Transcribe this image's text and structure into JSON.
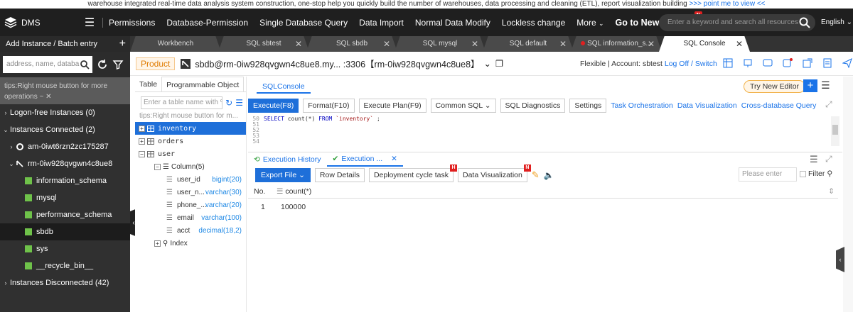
{
  "banner": {
    "text": "warehouse integrated real-time data analysis system construction, one-stop help you quickly build the number of warehouses, data processing and cleaning (ETL), report visualization building",
    "link": ">>> point me to view <<"
  },
  "topbar": {
    "logo": "DMS",
    "nav": [
      "Permissions",
      "Database-Permission",
      "Single Database Query",
      "Data Import",
      "Normal Data Modify",
      "Lockless change",
      "More",
      "Go to New Version"
    ],
    "new_badge": "N",
    "search_placeholder": "Enter a keyword and search all resources",
    "language": "English"
  },
  "sidebar": {
    "header": "Add Instance / Batch entry",
    "search_placeholder": "address, name, databa",
    "tips": "tips:Right mouse button for more operations ~",
    "items": [
      {
        "label": "Logon-free Instances  (0)"
      },
      {
        "label": "Instances Connected  (2)"
      },
      {
        "label": "am-0iwt6rzn2zc175287"
      },
      {
        "label": "rm-0iw928qvgwn4c8ue8"
      },
      {
        "label": "information_schema"
      },
      {
        "label": "mysql"
      },
      {
        "label": "performance_schema"
      },
      {
        "label": "sbdb"
      },
      {
        "label": "sys"
      },
      {
        "label": "__recycle_bin__"
      },
      {
        "label": "Instances Disconnected  (42)"
      }
    ]
  },
  "tabs": [
    {
      "label": "Workbench"
    },
    {
      "label": "SQL sbtest"
    },
    {
      "label": "SQL sbdb"
    },
    {
      "label": "SQL mysql"
    },
    {
      "label": "SQL default"
    },
    {
      "label": "SQL information_s..."
    },
    {
      "label": "SQL Console"
    }
  ],
  "infobar": {
    "product": "Product",
    "connection": "sbdb@rm-0iw928qvgwn4c8ue8.my...  :3306【rm-0iw928qvgwn4c8ue8】",
    "account_prefix": "Flexible | Account: sbtest",
    "logoff": "Log Off / Switch"
  },
  "objects": {
    "tab_table": "Table",
    "tab_programmable": "Programmable Object",
    "search_placeholder": "Enter a table name with % f",
    "tips": "tips:Right mouse button for m...",
    "tables": [
      "inventory",
      "orders",
      "user"
    ],
    "column_group": "Column(5)",
    "columns": [
      {
        "name": "user_id",
        "type": "bigint(20)"
      },
      {
        "name": "user_n...",
        "type": "varchar(30)"
      },
      {
        "name": "phone_...",
        "type": "varchar(20)"
      },
      {
        "name": "email",
        "type": "varchar(100)"
      },
      {
        "name": "acct",
        "type": "decimal(18,2)"
      }
    ],
    "index_group": "Index"
  },
  "editor": {
    "tab": "SQLConsole",
    "try_new": "Try New Editor",
    "toolbar": {
      "execute": "Execute(F8)",
      "format": "Format(F10)",
      "plan": "Execute Plan(F9)",
      "common_sql": "Common SQL",
      "diagnostics": "SQL Diagnostics",
      "settings": "Settings",
      "links": [
        "Task Orchestration",
        "Data Visualization",
        "Cross-database Query"
      ]
    },
    "lines": [
      {
        "no": "50",
        "kw1": "SELECT",
        "fn": "count(*)",
        "kw2": "FROM",
        "tbl": "`inventory`",
        "tail": ";"
      },
      {
        "no": "51"
      },
      {
        "no": "52"
      },
      {
        "no": "53"
      },
      {
        "no": "54"
      }
    ]
  },
  "results": {
    "history_tab": "Execution History",
    "exec_tab": "Execution ...",
    "export": "Export File",
    "row_details": "Row Details",
    "deploy": "Deployment cycle task",
    "deploy_badge": "H",
    "visualization": "Data Visualization",
    "vis_badge": "N",
    "filter_placeholder": "Please enter",
    "filter_label": "Filter",
    "col_no": "No.",
    "col_name": "count(*)",
    "rows": [
      {
        "no": "1",
        "value": "100000"
      }
    ]
  }
}
